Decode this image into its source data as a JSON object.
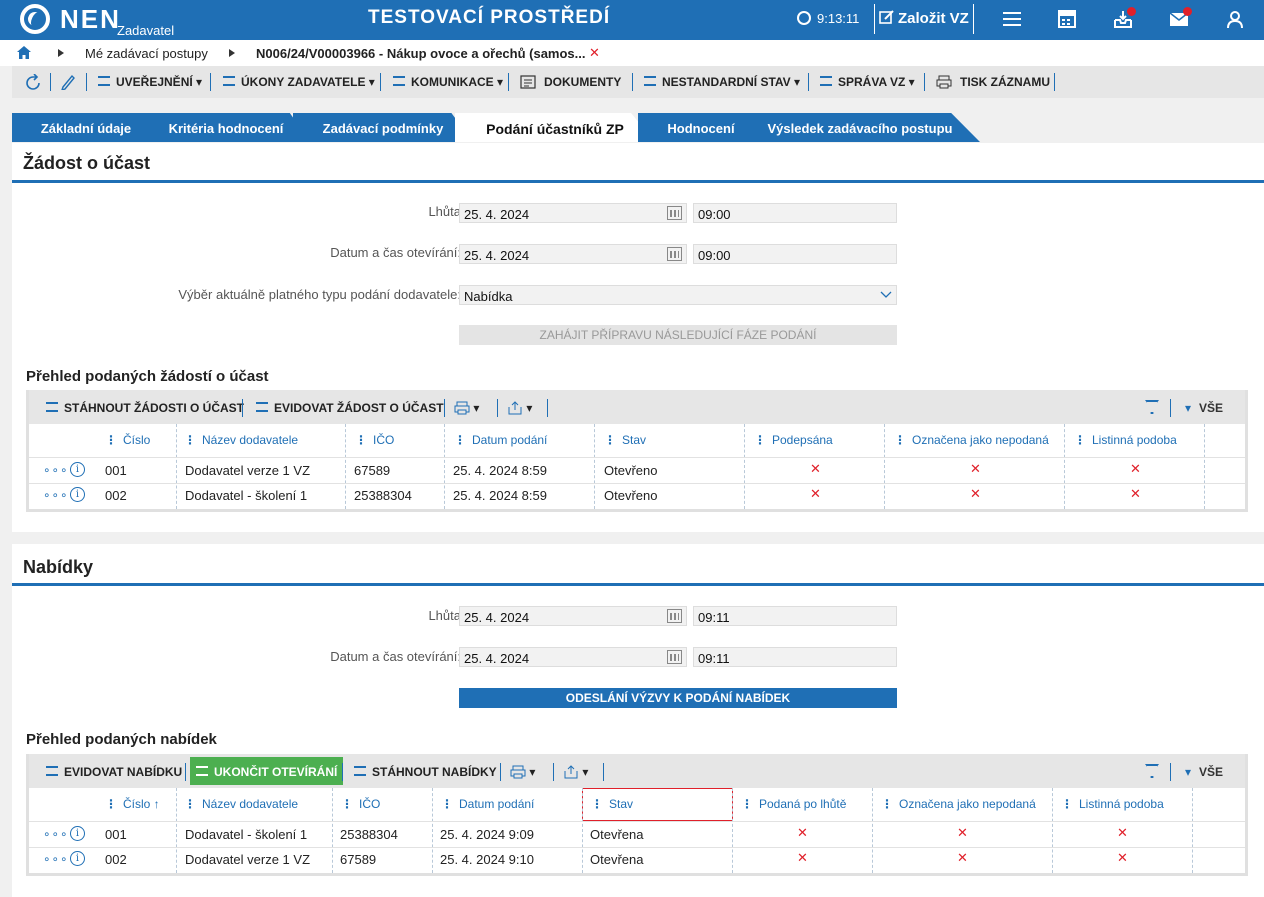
{
  "app": {
    "logo": "NEN",
    "logo_sub": "Zadavatel",
    "env_title": "TESTOVACÍ PROSTŘEDÍ",
    "clock": "9:13:11",
    "create_vz": "Založit VZ"
  },
  "breadcrumb": {
    "item1": "Mé zadávací postupy",
    "item2": "N006/24/V00003966 - Nákup ovoce a ořechů (samos...",
    "close": "✕"
  },
  "toolbar": {
    "uverejneni": "UVEŘEJNĚNÍ",
    "ukony": "ÚKONY ZADAVATELE",
    "komunikace": "KOMUNIKACE",
    "dokumenty": "DOKUMENTY",
    "nestandardni": "NESTANDARDNÍ STAV",
    "sprava": "SPRÁVA VZ",
    "tisk": "TISK ZÁZNAMU"
  },
  "tabs": [
    "Základní údaje",
    "Kritéria hodnocení",
    "Zadávací podmínky",
    "Podání účastníků ZP",
    "Hodnocení",
    "Výsledek zadávacího postupu"
  ],
  "zadost": {
    "title": "Žádost o účast",
    "lhuta_label": "Lhůta",
    "lhuta_date": "25. 4. 2024",
    "lhuta_time": "09:00",
    "otevirani_label": "Datum a čas otevírání:",
    "otevirani_date": "25. 4. 2024",
    "otevirani_time": "09:00",
    "vyber_label": "Výběr aktuálně platného typu podání dodavatele:",
    "vyber_value": "Nabídka",
    "btn_zahajit": "ZAHÁJIT PŘÍPRAVU NÁSLEDUJÍCÍ FÁZE PODÁNÍ",
    "prehled_title": "Přehled podaných žádostí o účast",
    "tb_stahnout": "STÁHNOUT ŽÁDOSTI O ÚČAST",
    "tb_evidovat": "EVIDOVAT ŽÁDOST O ÚČAST",
    "tb_vse": "VŠE",
    "headers": [
      "Číslo",
      "Název dodavatele",
      "IČO",
      "Datum podání",
      "Stav",
      "Podepsána",
      "Označena jako nepodaná",
      "Listinná podoba"
    ],
    "rows": [
      {
        "cislo": "001",
        "nazev": "Dodavatel verze 1 VZ",
        "ico": "67589",
        "datum": "25. 4. 2024 8:59",
        "stav": "Otevřeno"
      },
      {
        "cislo": "002",
        "nazev": "Dodavatel - školení 1",
        "ico": "25388304",
        "datum": "25. 4. 2024 8:59",
        "stav": "Otevřeno"
      }
    ]
  },
  "nabidky": {
    "title": "Nabídky",
    "lhuta_label": "Lhůta",
    "lhuta_date": "25. 4. 2024",
    "lhuta_time": "09:11",
    "otevirani_label": "Datum a čas otevírání:",
    "otevirani_date": "25. 4. 2024",
    "otevirani_time": "09:11",
    "btn_odeslani": "ODESLÁNÍ VÝZVY K PODÁNÍ NABÍDEK",
    "prehled_title": "Přehled podaných nabídek",
    "tb_evidovat": "EVIDOVAT NABÍDKU",
    "tb_ukoncit": "UKONČIT OTEVÍRÁNÍ",
    "tb_stahnout": "STÁHNOUT NABÍDKY",
    "tb_vse": "VŠE",
    "headers": [
      "Číslo ↑",
      "Název dodavatele",
      "IČO",
      "Datum podání",
      "Stav",
      "Podaná po lhůtě",
      "Označena jako nepodaná",
      "Listinná podoba"
    ],
    "rows": [
      {
        "cislo": "001",
        "nazev": "Dodavatel - školení 1",
        "ico": "25388304",
        "datum": "25. 4. 2024 9:09",
        "stav": "Otevřena"
      },
      {
        "cislo": "002",
        "nazev": "Dodavatel verze 1 VZ",
        "ico": "67589",
        "datum": "25. 4. 2024 9:10",
        "stav": "Otevřena"
      }
    ]
  },
  "mark": "✕",
  "row_dots": "∘∘∘",
  "info_glyph": "i"
}
